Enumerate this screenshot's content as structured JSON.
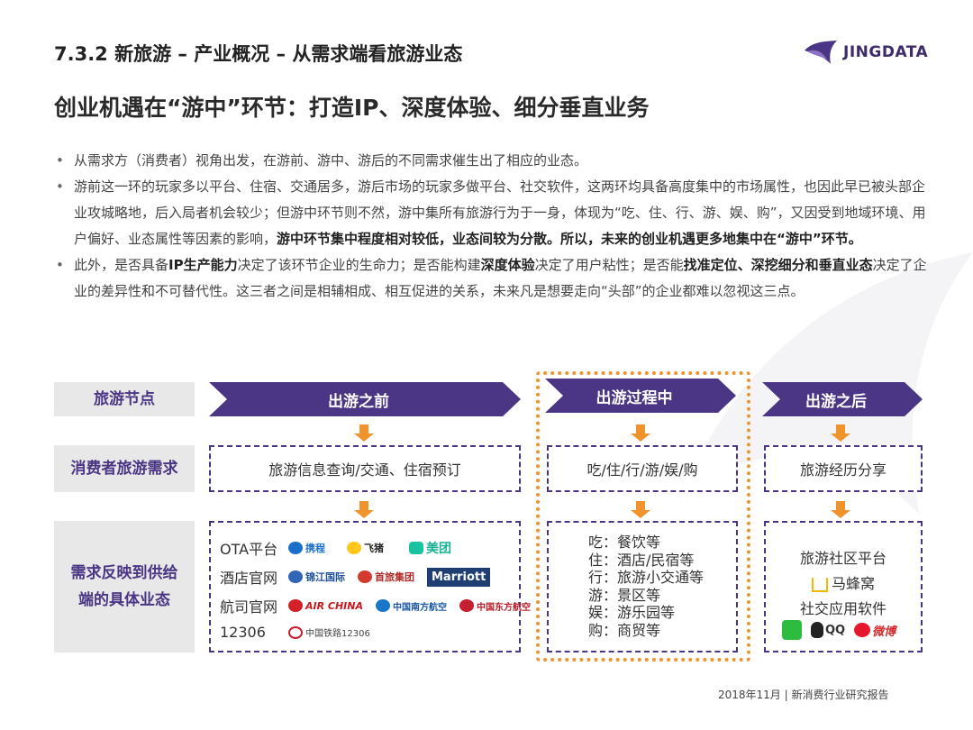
{
  "header": {
    "section_title": "7.3.2 新旅游 – 产业概况 – 从需求端看旅游业态",
    "logo_text": "JINGDATA"
  },
  "headline": "创业机遇在“游中”环节：打造IP、深度体验、细分垂直业务",
  "bullets": {
    "b1": "从需求方（消费者）视角出发，在游前、游中、游后的不同需求催生出了相应的业态。",
    "b2_text": "游前这一环的玩家多以平台、住宿、交通居多，游后市场的玩家多做平台、社交软件，这两环均具备高度集中的市场属性，也因此早已被头部企业攻城略地，后入局者机会较少；但游中环节则不然，游中集所有旅游行为于一身，体现为“吃、住、行、游、娱、购”，又因受到地域环境、用户偏好、业态属性等因素的影响，",
    "b2_bold": "游中环节集中程度相对较低，业态间较为分散。所以，未来的创业机遇更多地集中在“游中”环节。",
    "b3_p1": "此外，是否具备",
    "b3_bold1": "IP生产能力",
    "b3_p2": "决定了该环节企业的生命力；是否能构建",
    "b3_bold2": "深度体验",
    "b3_p3": "决定了用户粘性；是否能",
    "b3_bold3": "找准定位、深挖细分和垂直业态",
    "b3_p4": "决定了企业的差异性和不可替代性。这三者之间是相辅相成、相互促进的关系，未来凡是想要走向“头部”的企业都难以忽视这三点。"
  },
  "diagram": {
    "row_labels": {
      "node": "旅游节点",
      "demand": "消费者旅游需求",
      "business": "需求反映到供给端的具体业态"
    },
    "phases": {
      "before": "出游之前",
      "during": "出游过程中",
      "after": "出游之后"
    },
    "demands": {
      "before": "旅游信息查询/交通、住宿预订",
      "during": "吃/住/行/游/娱/购",
      "after": "旅游经历分享"
    },
    "before_business": {
      "rows": [
        {
          "label": "OTA平台",
          "brands": [
            "携程",
            "飞猪",
            "美团"
          ]
        },
        {
          "label": "酒店官网",
          "brands": [
            "锦江国际",
            "首旅集团",
            "Marriott"
          ]
        },
        {
          "label": "航司官网",
          "brands": [
            "AIR CHINA",
            "中国南方航空",
            "中国东方航空"
          ]
        },
        {
          "label": "12306",
          "brands": [
            "中国铁路12306"
          ]
        }
      ]
    },
    "during_business": [
      "吃：餐饮等",
      "住：酒店/民宿等",
      "行：旅游小交通等",
      "游：景区等",
      "娱：游乐园等",
      "购：商贸等"
    ],
    "after_business": {
      "community_title": "旅游社区平台",
      "community_brand": "马蜂窝",
      "social_title": "社交应用软件",
      "social_brands": [
        "QQ",
        "微博"
      ]
    },
    "colors": {
      "purple": "#4b3585",
      "orange": "#f0932c",
      "label_bg": "#e8e8e8"
    }
  },
  "footer": "2018年11月 | 新消费行业研究报告"
}
